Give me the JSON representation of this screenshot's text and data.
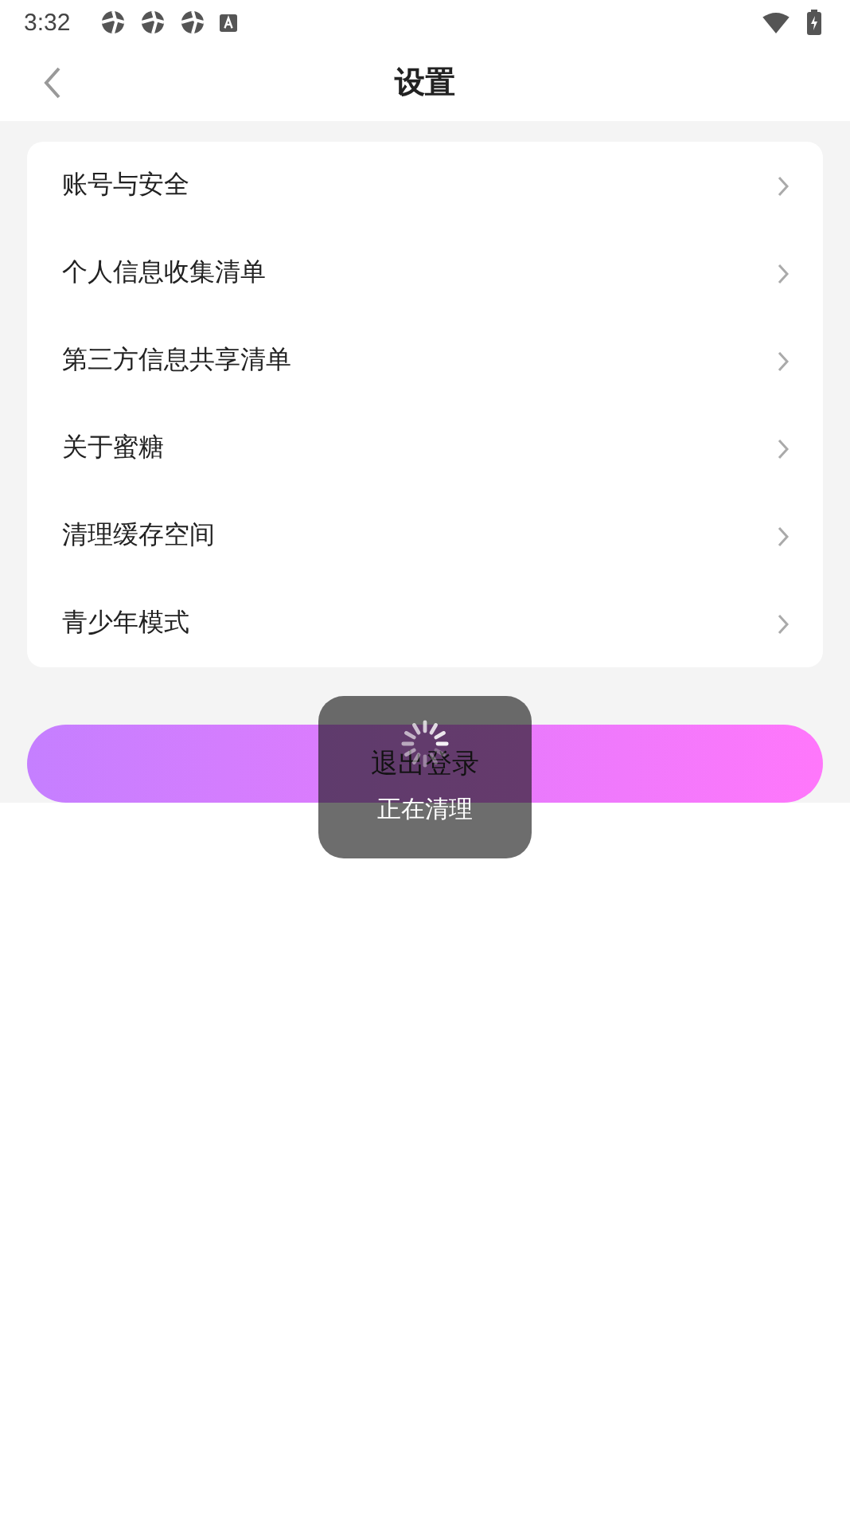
{
  "status_bar": {
    "time": "3:32"
  },
  "header": {
    "title": "设置"
  },
  "menu": [
    {
      "label": "账号与安全"
    },
    {
      "label": "个人信息收集清单"
    },
    {
      "label": "第三方信息共享清单"
    },
    {
      "label": "关于蜜糖"
    },
    {
      "label": "清理缓存空间"
    },
    {
      "label": "青少年模式"
    }
  ],
  "logout_button": {
    "label": "退出登录"
  },
  "toast": {
    "text": "正在清理"
  }
}
